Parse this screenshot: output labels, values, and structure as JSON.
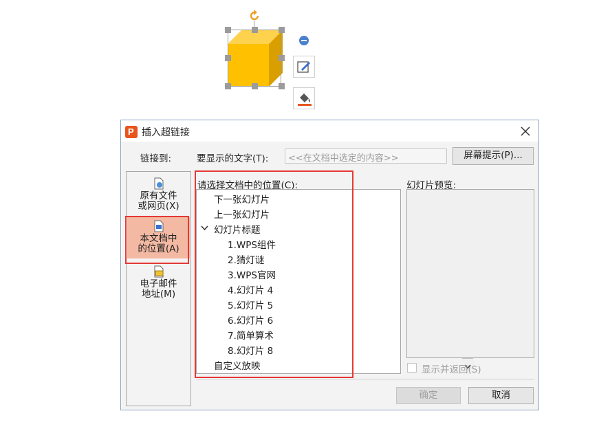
{
  "dialog": {
    "title": "插入超链接",
    "link_to_label": "链接到:",
    "display_text_label": "要显示的文字(T):",
    "display_text_value": "<<在文档中选定的内容>>",
    "screen_tip_button": "屏幕提示(P)...",
    "nav": [
      {
        "line1": "原有文件",
        "line2": "或网页(X)",
        "icon": "file-web-icon"
      },
      {
        "line1": "本文档中",
        "line2": "的位置(A)",
        "icon": "document-place-icon"
      },
      {
        "line1": "电子邮件",
        "line2": "地址(M)",
        "icon": "email-icon"
      }
    ],
    "place_label": "请选择文档中的位置(C):",
    "tree": [
      {
        "label": "下一张幻灯片"
      },
      {
        "label": "上一张幻灯片"
      },
      {
        "label": "幻灯片标题"
      },
      {
        "label": "1.WPS组件"
      },
      {
        "label": "2.猜灯谜"
      },
      {
        "label": "3.WPS官网"
      },
      {
        "label": "4.幻灯片 4"
      },
      {
        "label": "5.幻灯片 5"
      },
      {
        "label": "6.幻灯片 6"
      },
      {
        "label": "7.简单算术"
      },
      {
        "label": "8.幻灯片 8"
      },
      {
        "label": "自定义放映"
      }
    ],
    "preview_label": "幻灯片预览:",
    "show_return_label": "显示并返回(S)",
    "ok_button": "确定",
    "cancel_button": "取消"
  },
  "colors": {
    "cube_face": "#FFC000",
    "cube_side": "#D99E00",
    "selected_nav": "#F3B9A3",
    "highlight_border": "#E53935",
    "rotate_handle": "#F0A020"
  }
}
